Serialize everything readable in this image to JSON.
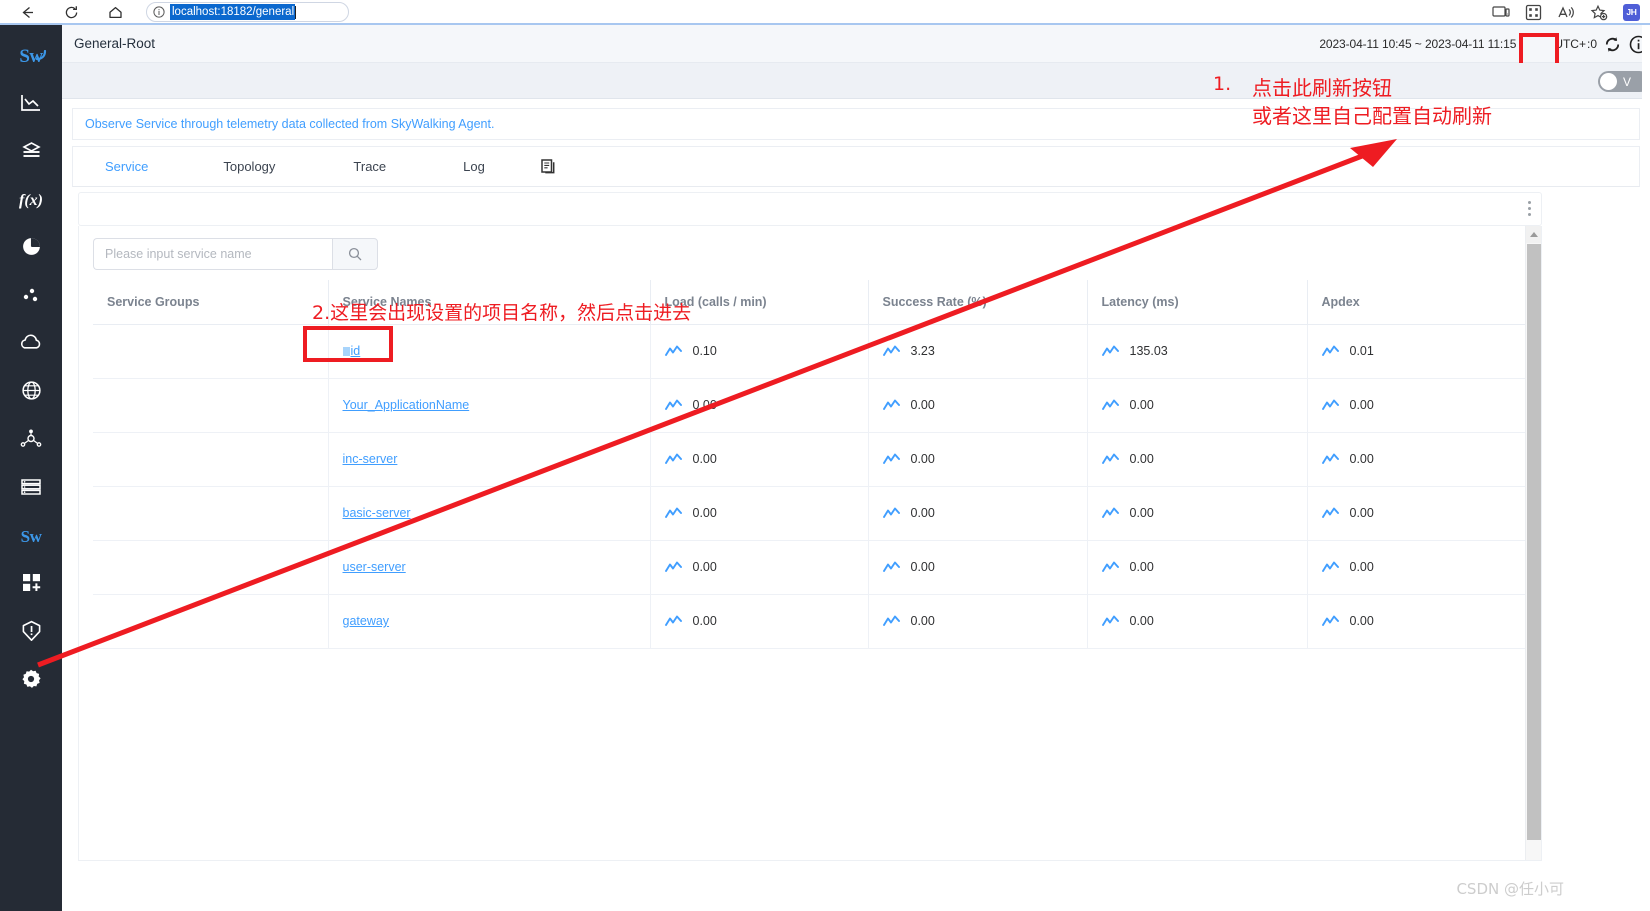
{
  "browser": {
    "url": "localhost:18182/general",
    "back_icon": "back-arrow-icon",
    "reload_icon": "reload-icon",
    "home_icon": "home-icon",
    "info_icon": "info-circle-icon",
    "toolbar_icons": [
      "device-cast-icon",
      "collections-icon",
      "read-aloud-icon",
      "add-favorite-icon"
    ],
    "profile_initials": "JH"
  },
  "sidebar": {
    "logo": "Sw",
    "items": [
      {
        "name": "skywalking-logo",
        "icon": "sw-logo-icon",
        "label": "Sw"
      },
      {
        "name": "sidebar-item-dashboard",
        "icon": "chart-decline-icon",
        "label": ""
      },
      {
        "name": "sidebar-item-service",
        "icon": "layers-icon",
        "label": ""
      },
      {
        "name": "sidebar-item-function",
        "icon": "function-fx-icon",
        "label": ""
      },
      {
        "name": "sidebar-item-pie",
        "icon": "pie-chart-icon",
        "label": ""
      },
      {
        "name": "sidebar-item-scatter",
        "icon": "scatter-dots-icon",
        "label": ""
      },
      {
        "name": "sidebar-item-cloud",
        "icon": "cloud-icon",
        "label": ""
      },
      {
        "name": "sidebar-item-network",
        "icon": "globe-icon",
        "label": ""
      },
      {
        "name": "sidebar-item-topology",
        "icon": "topology-icon",
        "label": ""
      },
      {
        "name": "sidebar-item-list",
        "icon": "list-icon",
        "label": ""
      },
      {
        "name": "sidebar-item-agent",
        "icon": "sw-small-icon",
        "label": "Sw"
      },
      {
        "name": "sidebar-item-add-widget",
        "icon": "add-grid-icon",
        "label": ""
      },
      {
        "name": "sidebar-item-alarm",
        "icon": "alert-shield-icon",
        "label": ""
      },
      {
        "name": "sidebar-item-settings",
        "icon": "gear-icon",
        "label": ""
      }
    ]
  },
  "header": {
    "title": "General-Root",
    "time_range": "2023-04-11 10:45 ~ 2023-04-11 11:15",
    "utc_label": "UTC+",
    "utc_offset": ":0",
    "refresh_icon": "refresh-icon",
    "info_icon": "info-circle-icon"
  },
  "toggle": {
    "label": "V",
    "state": "off"
  },
  "banner": {
    "text": "Observe Service through telemetry data collected from SkyWalking Agent."
  },
  "tabs": [
    {
      "id": "service",
      "label": "Service",
      "active": true
    },
    {
      "id": "topology",
      "label": "Topology",
      "active": false
    },
    {
      "id": "trace",
      "label": "Trace",
      "active": false
    },
    {
      "id": "log",
      "label": "Log",
      "active": false
    }
  ],
  "tab_copy_icon": "copy-pages-icon",
  "panel": {
    "menu_icon": "vertical-dots-icon"
  },
  "search": {
    "placeholder": "Please input service name",
    "value": "",
    "button_icon": "search-icon"
  },
  "table": {
    "columns": [
      "Service Groups",
      "Service Names",
      "Load (calls / min)",
      "Success Rate (%)",
      "Latency (ms)",
      "Apdex"
    ],
    "rows": [
      {
        "group": "",
        "name": "id",
        "has_chip": true,
        "load": "0.10",
        "success_rate": "3.23",
        "latency": "135.03",
        "apdex": "0.01"
      },
      {
        "group": "",
        "name": "Your_ApplicationName",
        "has_chip": false,
        "load": "0.00",
        "success_rate": "0.00",
        "latency": "0.00",
        "apdex": "0.00"
      },
      {
        "group": "",
        "name": "inc-server",
        "has_chip": false,
        "load": "0.00",
        "success_rate": "0.00",
        "latency": "0.00",
        "apdex": "0.00"
      },
      {
        "group": "",
        "name": "basic-server",
        "has_chip": false,
        "load": "0.00",
        "success_rate": "0.00",
        "latency": "0.00",
        "apdex": "0.00"
      },
      {
        "group": "",
        "name": "user-server",
        "has_chip": false,
        "load": "0.00",
        "success_rate": "0.00",
        "latency": "0.00",
        "apdex": "0.00"
      },
      {
        "group": "",
        "name": "gateway",
        "has_chip": false,
        "load": "0.00",
        "success_rate": "0.00",
        "latency": "0.00",
        "apdex": "0.00"
      }
    ],
    "metric_icon": "sparkline-icon"
  },
  "annotations": {
    "number_1": "1.",
    "line_1": "点击此刷新按钮",
    "line_2": "或者这里自己配置自动刷新",
    "step_2": "2.这里会出现设置的项目名称，然后点击进去",
    "color": "#ee1c22"
  },
  "watermark": "CSDN @任小可"
}
